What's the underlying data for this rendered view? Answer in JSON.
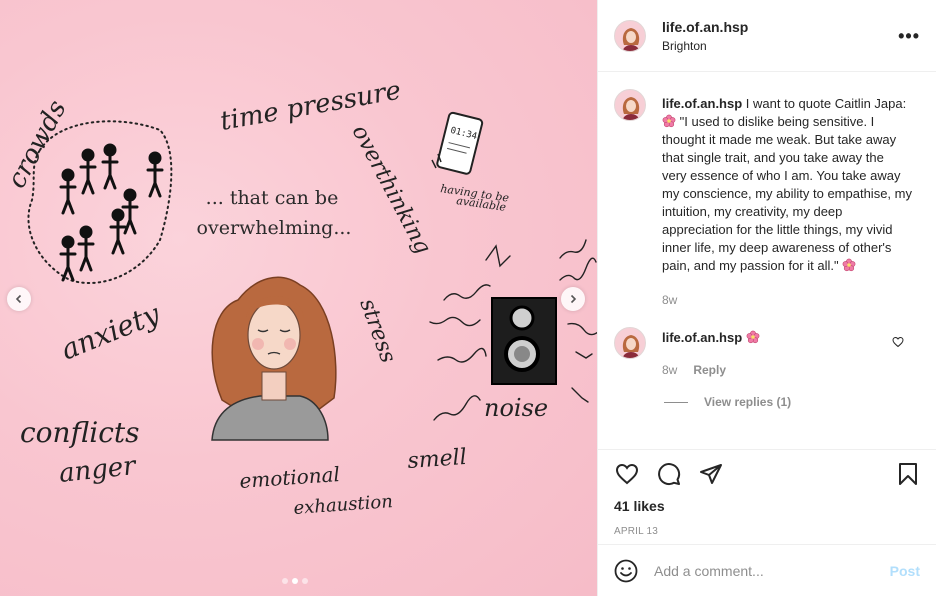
{
  "post": {
    "username": "life.of.an.hsp",
    "location": "Brighton",
    "more_label": "•••"
  },
  "illustration": {
    "caption_line1": "... that can be",
    "caption_line2": "overwhelming...",
    "labels": {
      "crowds": "crowds",
      "time_pressure": "time pressure",
      "overthinking": "overthinking",
      "having_to_be": "having to be",
      "available": "available",
      "phone_time": "01:34",
      "anxiety": "anxiety",
      "stress": "stress",
      "conflicts": "conflicts",
      "anger": "anger",
      "noise": "noise",
      "smell": "smell",
      "emotional": "emotional",
      "exhaustion": "exhaustion"
    },
    "carousel": {
      "current": 2,
      "total": 3
    }
  },
  "caption": {
    "username": "life.of.an.hsp",
    "text": "I want to quote Caitlin Japa:",
    "quote": "\"I used to dislike being sensitive. I thought it made me weak. But take away that single trait, and you take away the very essence of who I am. You take away my conscience, my ability to empathise, my intuition, my creativity, my deep appreciation for the little things, my vivid inner life, my deep awareness of other's pain, and my passion for it all.\"",
    "age": "8w"
  },
  "comment": {
    "username": "life.of.an.hsp",
    "age": "8w",
    "reply_label": "Reply",
    "view_replies": "View replies (1)"
  },
  "engagement": {
    "likes": "41 likes",
    "date": "APRIL 13"
  },
  "add_comment": {
    "placeholder": "Add a comment...",
    "post_label": "Post"
  },
  "colors": {
    "background_pink": "#f9c6d0",
    "post_button": "#b2dffc",
    "muted_text": "#8e8e8e",
    "flower_emoji": "#f07aa6"
  }
}
